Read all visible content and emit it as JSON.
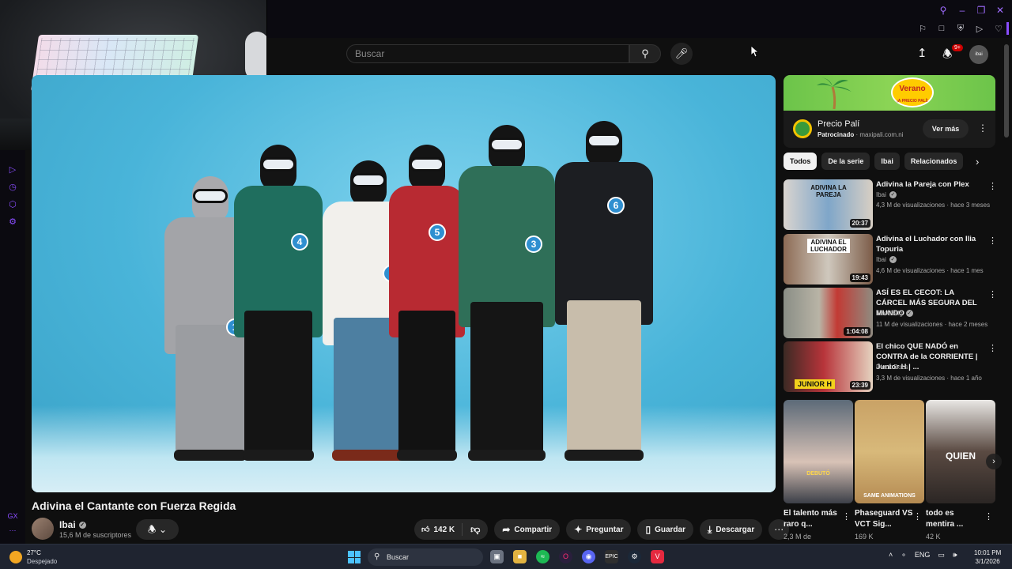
{
  "header": {
    "search_placeholder": "Buscar",
    "notifications_badge": "9+",
    "avatar_text": "ibai"
  },
  "video": {
    "title": "Adivina el Cantante con Fuerza Regida",
    "channel": "Ibai",
    "subscribers": "15,6 M de suscriptores",
    "likes": "142 K",
    "share_label": "Compartir",
    "ask_label": "Preguntar",
    "save_label": "Guardar",
    "download_label": "Descargar",
    "contestant_numbers": [
      "1",
      "4",
      "2",
      "5",
      "3",
      "6"
    ]
  },
  "ad": {
    "banner_text": "Verano",
    "banner_subtext": "¡A PRECIO PALÍ!",
    "name": "Precio Palí",
    "sponsored": "Patrocinado",
    "domain": "maxipali.com.ni",
    "cta": "Ver más"
  },
  "chips": [
    "Todos",
    "De la serie",
    "Ibai",
    "Relacionados"
  ],
  "recommendations": [
    {
      "title": "Adivina la Pareja con Plex",
      "channel": "Ibai",
      "meta": "4,3 M de visualizaciones · hace 3 meses",
      "duration": "20:37",
      "thumb_text": "ADIVINA LA PAREJA"
    },
    {
      "title": "Adivina el Luchador con Ilia Topuria",
      "channel": "Ibai",
      "meta": "4,6 M de visualizaciones · hace 1 mes",
      "duration": "19:43",
      "thumb_text": "ADIVINA EL LUCHADOR"
    },
    {
      "title": "ASÍ ES EL CECOT: LA CÁRCEL MÁS SEGURA DEL MUNDO",
      "channel": "TheGrefg",
      "meta": "11 M de visualizaciones · hace 2 meses",
      "duration": "1:04:08",
      "thumb_text": ""
    },
    {
      "title": "El chico QUE NADÓ en CONTRA de la CORRIENTE | Junior H | ...",
      "channel": "Dieck Docs",
      "meta": "3,3 M de visualizaciones · hace 1 año",
      "duration": "23:39",
      "thumb_text": "JUNIOR H"
    }
  ],
  "shorts": [
    {
      "title": "El talento más raro q...",
      "views": "2,3 M de",
      "thumb_text": "DEBUTÓ"
    },
    {
      "title": "Phaseguard VS VCT Sig...",
      "views": "169 K",
      "thumb_text": "SAME ANIMATIONS"
    },
    {
      "title": "todo es mentira ...",
      "views": "42 K",
      "thumb_text": "QUIEN"
    }
  ],
  "taskbar": {
    "temperature": "27°C",
    "condition": "Despejado",
    "search_label": "Buscar",
    "language": "ENG",
    "time": "10:01 PM",
    "date": "3/1/2026"
  },
  "browser": {
    "sidebar_label": "GX"
  },
  "colors": {
    "accent_gx": "#8a4dff",
    "yt_bg": "#0f0f0f",
    "stage_blue": "#49b4d9"
  }
}
